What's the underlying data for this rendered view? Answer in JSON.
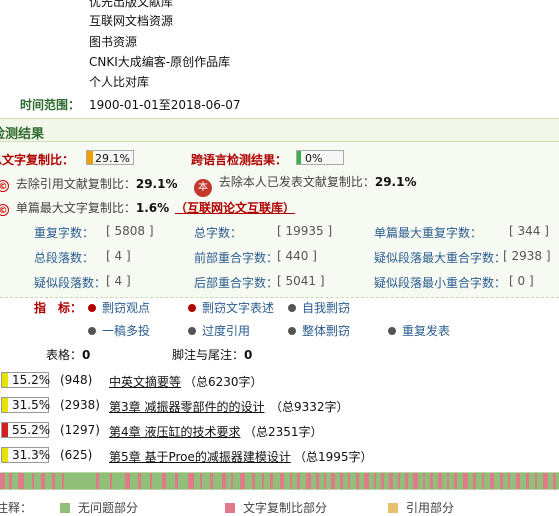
{
  "sources": {
    "items": [
      "优先出版文献库",
      "互联网文档资源",
      "图书资源",
      "CNKI大成编客-原创作品库",
      "个人比对库"
    ]
  },
  "time_range": {
    "label": "时间范围：",
    "value": "1900-01-01至2018-06-07"
  },
  "results": {
    "title": "检测结果",
    "total_copy_label": "总文字复制比：",
    "total_copy_value": "29.1%",
    "total_copy_fraction": 0.291,
    "cross_lang_label": "跨语言检测结果：",
    "cross_lang_value": "0%",
    "cross_lang_fraction": 0.0,
    "exclude_ref_label": "去除引用文献复制比：",
    "exclude_ref_value": "29.1%",
    "exclude_self_label": "去除本人已发表文献复制比：",
    "exclude_self_value": "29.1%",
    "ben_icon": "本",
    "single_max_label": "单篇最大文字复制比：",
    "single_max_value": "1.6%",
    "single_max_source": "（互联网论文互联库）"
  },
  "stats": {
    "rows": [
      [
        {
          "label": "重复字数：",
          "value": "[ 5808 ]"
        },
        {
          "label": "总字数：",
          "value": "[ 19935 ]"
        },
        {
          "label": "单篇最大重复字数：",
          "value": "[ 344 ]"
        }
      ],
      [
        {
          "label": "总段落数：",
          "value": "[ 4 ]"
        },
        {
          "label": "前部重合字数：",
          "value": "[ 440 ]"
        },
        {
          "label": "疑似段落最大重合字数：",
          "value": "[ 2938 ]"
        }
      ],
      [
        {
          "label": "疑似段落数：",
          "value": "[ 4 ]"
        },
        {
          "label": "后部重合字数：",
          "value": "[ 5041 ]"
        },
        {
          "label": "疑似段落最小重合字数：",
          "value": "[ 0 ]"
        }
      ]
    ]
  },
  "indicators": {
    "label": "指　标：",
    "items": [
      {
        "label": "剽窃观点",
        "color": "#b00000"
      },
      {
        "label": "剽窃文字表述",
        "color": "#b00000"
      },
      {
        "label": "自我剽窃",
        "color": "#555555"
      },
      {
        "label": "一稿多投",
        "color": "#555555"
      },
      {
        "label": "过度引用",
        "color": "#555555"
      },
      {
        "label": "整体剽窃",
        "color": "#555555"
      },
      {
        "label": "重复发表",
        "color": "#555555"
      }
    ]
  },
  "tables_label": "表格：",
  "tables_value": "0",
  "footnote_label": "脚注与尾注：",
  "footnote_value": "0",
  "sections": [
    {
      "pct": "15.2%",
      "fraction": 0.152,
      "count": "(948)",
      "title": "中英文摘要等",
      "words": "（总6230字）",
      "color": "#e9e200"
    },
    {
      "pct": "31.5%",
      "fraction": 0.315,
      "count": "(2938)",
      "title": "第3章 减振器零部件的的设计",
      "words": "（总9332字）",
      "color": "#e9e200"
    },
    {
      "pct": "55.2%",
      "fraction": 0.552,
      "count": "(1297)",
      "title": "第4章 液压缸的技术要求",
      "words": "（总2351字）",
      "color": "#d22020"
    },
    {
      "pct": "31.3%",
      "fraction": 0.313,
      "count": "(625)",
      "title": "第5章 基于Proe的减振器建模设计",
      "words": "（总1995字）",
      "color": "#e9e200"
    }
  ],
  "legend": {
    "label": "注释：",
    "items": [
      {
        "label": "无问题部分",
        "color": "#8fbf78"
      },
      {
        "label": "文字复制比部分",
        "color": "#e07a8a"
      },
      {
        "label": "引用部分",
        "color": "#e8c070"
      }
    ]
  }
}
